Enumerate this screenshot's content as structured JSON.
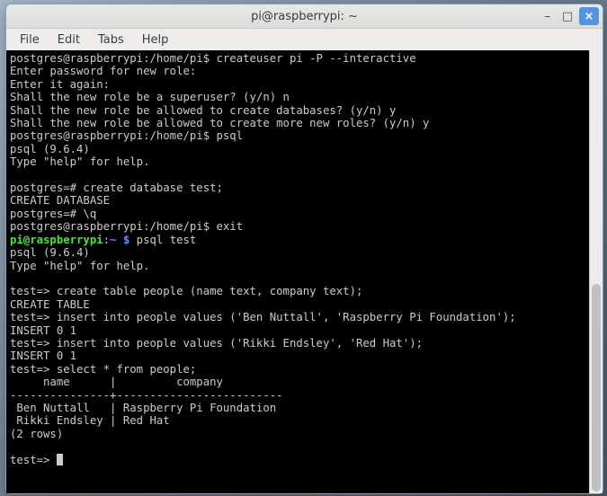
{
  "window": {
    "title": "pi@raspberrypi: ~"
  },
  "menubar": {
    "items": [
      {
        "label": "File"
      },
      {
        "label": "Edit"
      },
      {
        "label": "Tabs"
      },
      {
        "label": "Help"
      }
    ]
  },
  "terminal": {
    "lines": [
      {
        "segments": [
          {
            "cls": "c-white",
            "text": "postgres@raspberrypi:/home/pi$ createuser pi -P --interactive"
          }
        ]
      },
      {
        "segments": [
          {
            "cls": "c-white",
            "text": "Enter password for new role:"
          }
        ]
      },
      {
        "segments": [
          {
            "cls": "c-white",
            "text": "Enter it again:"
          }
        ]
      },
      {
        "segments": [
          {
            "cls": "c-white",
            "text": "Shall the new role be a superuser? (y/n) n"
          }
        ]
      },
      {
        "segments": [
          {
            "cls": "c-white",
            "text": "Shall the new role be allowed to create databases? (y/n) y"
          }
        ]
      },
      {
        "segments": [
          {
            "cls": "c-white",
            "text": "Shall the new role be allowed to create more new roles? (y/n) y"
          }
        ]
      },
      {
        "segments": [
          {
            "cls": "c-white",
            "text": "postgres@raspberrypi:/home/pi$ psql"
          }
        ]
      },
      {
        "segments": [
          {
            "cls": "c-white",
            "text": "psql (9.6.4)"
          }
        ]
      },
      {
        "segments": [
          {
            "cls": "c-white",
            "text": "Type \"help\" for help."
          }
        ]
      },
      {
        "segments": [
          {
            "cls": "c-white",
            "text": ""
          }
        ]
      },
      {
        "segments": [
          {
            "cls": "c-white",
            "text": "postgres=# create database test;"
          }
        ]
      },
      {
        "segments": [
          {
            "cls": "c-white",
            "text": "CREATE DATABASE"
          }
        ]
      },
      {
        "segments": [
          {
            "cls": "c-white",
            "text": "postgres=# \\q"
          }
        ]
      },
      {
        "segments": [
          {
            "cls": "c-white",
            "text": "postgres@raspberrypi:/home/pi$ exit"
          }
        ]
      },
      {
        "segments": [
          {
            "cls": "c-green",
            "text": "pi@raspberrypi"
          },
          {
            "cls": "c-white",
            "text": ":"
          },
          {
            "cls": "c-blue",
            "text": "~ $"
          },
          {
            "cls": "c-white",
            "text": " psql test"
          }
        ]
      },
      {
        "segments": [
          {
            "cls": "c-white",
            "text": "psql (9.6.4)"
          }
        ]
      },
      {
        "segments": [
          {
            "cls": "c-white",
            "text": "Type \"help\" for help."
          }
        ]
      },
      {
        "segments": [
          {
            "cls": "c-white",
            "text": ""
          }
        ]
      },
      {
        "segments": [
          {
            "cls": "c-white",
            "text": "test=> create table people (name text, company text);"
          }
        ]
      },
      {
        "segments": [
          {
            "cls": "c-white",
            "text": "CREATE TABLE"
          }
        ]
      },
      {
        "segments": [
          {
            "cls": "c-white",
            "text": "test=> insert into people values ('Ben Nuttall', 'Raspberry Pi Foundation');"
          }
        ]
      },
      {
        "segments": [
          {
            "cls": "c-white",
            "text": "INSERT 0 1"
          }
        ]
      },
      {
        "segments": [
          {
            "cls": "c-white",
            "text": "test=> insert into people values ('Rikki Endsley', 'Red Hat');"
          }
        ]
      },
      {
        "segments": [
          {
            "cls": "c-white",
            "text": "INSERT 0 1"
          }
        ]
      },
      {
        "segments": [
          {
            "cls": "c-white",
            "text": "test=> select * from people;"
          }
        ]
      },
      {
        "segments": [
          {
            "cls": "c-white",
            "text": "     name      |         company"
          }
        ]
      },
      {
        "segments": [
          {
            "cls": "c-white",
            "text": "---------------+-------------------------"
          }
        ]
      },
      {
        "segments": [
          {
            "cls": "c-white",
            "text": " Ben Nuttall   | Raspberry Pi Foundation"
          }
        ]
      },
      {
        "segments": [
          {
            "cls": "c-white",
            "text": " Rikki Endsley | Red Hat"
          }
        ]
      },
      {
        "segments": [
          {
            "cls": "c-white",
            "text": "(2 rows)"
          }
        ]
      },
      {
        "segments": [
          {
            "cls": "c-white",
            "text": ""
          }
        ]
      },
      {
        "segments": [
          {
            "cls": "c-white",
            "text": "test=> "
          }
        ],
        "cursor": true
      }
    ]
  },
  "window_controls": {
    "minimize": "–",
    "maximize": "□",
    "close": "×"
  }
}
